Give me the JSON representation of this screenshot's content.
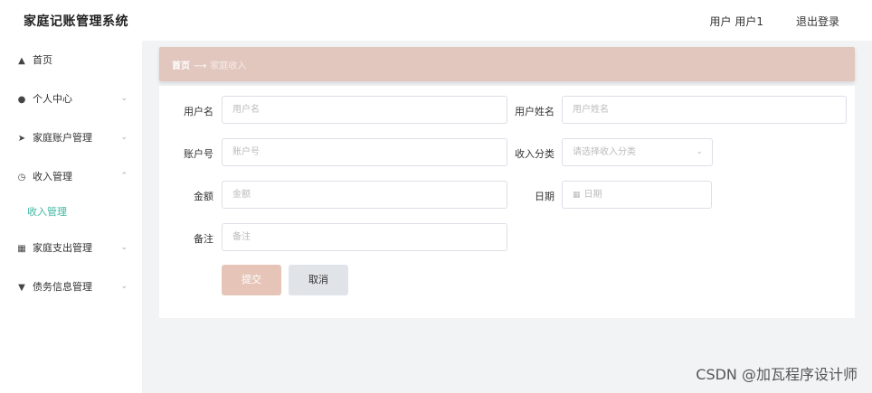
{
  "header": {
    "app_title": "家庭记账管理系统",
    "user_label": "用户 用户1",
    "logout_label": "退出登录"
  },
  "sidebar": {
    "items": [
      {
        "label": "首页",
        "icon": "home-icon"
      },
      {
        "label": "个人中心",
        "icon": "user-icon"
      },
      {
        "label": "家庭账户管理",
        "icon": "send-icon"
      },
      {
        "label": "收入管理",
        "icon": "clock-icon"
      },
      {
        "label": "家庭支出管理",
        "icon": "grid-icon"
      },
      {
        "label": "债务信息管理",
        "icon": "pin-icon"
      }
    ],
    "sub_item": {
      "label": "收入管理"
    }
  },
  "breadcrumb": {
    "home": "首页",
    "current": "家庭收入"
  },
  "form": {
    "username": {
      "label": "用户名",
      "placeholder": "用户名"
    },
    "realname": {
      "label": "用户姓名",
      "placeholder": "用户姓名"
    },
    "account": {
      "label": "账户号",
      "placeholder": "账户号"
    },
    "category": {
      "label": "收入分类",
      "placeholder": "请选择收入分类"
    },
    "amount": {
      "label": "金额",
      "placeholder": "金额"
    },
    "date": {
      "label": "日期",
      "placeholder": "日期"
    },
    "note": {
      "label": "备注",
      "placeholder": "备注"
    },
    "submit_label": "提交",
    "cancel_label": "取消"
  },
  "watermark": "CSDN @加瓦程序设计师",
  "colors": {
    "accent": "#3cb6a3",
    "breadcrumb_bg": "#e2c7bf",
    "submit_bg": "#e6c5b8",
    "cancel_bg": "#e0e3e8"
  }
}
